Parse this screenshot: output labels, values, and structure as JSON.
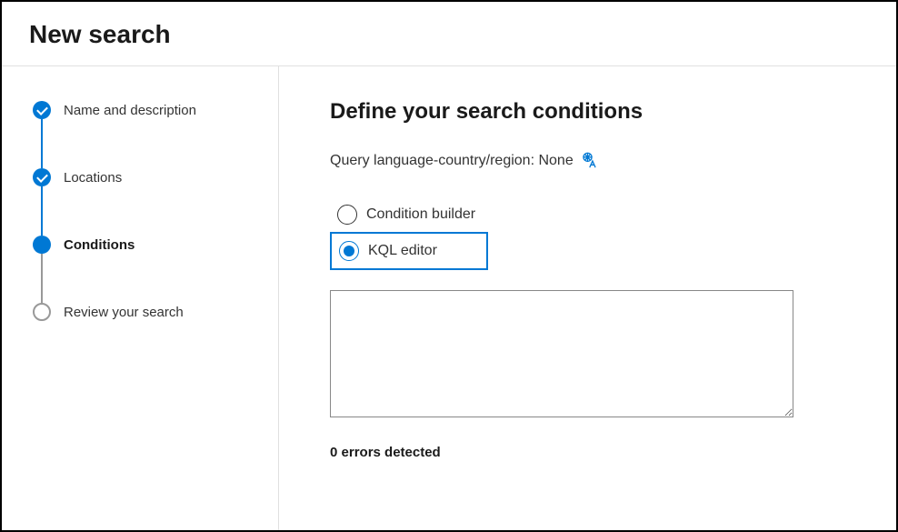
{
  "header": {
    "title": "New search"
  },
  "sidebar": {
    "steps": [
      {
        "label": "Name and description",
        "state": "completed"
      },
      {
        "label": "Locations",
        "state": "completed"
      },
      {
        "label": "Conditions",
        "state": "current"
      },
      {
        "label": "Review your search",
        "state": "pending"
      }
    ]
  },
  "main": {
    "heading": "Define your search conditions",
    "query_lang_label": "Query language-country/region: None",
    "radio_options": {
      "condition_builder": "Condition builder",
      "kql_editor": "KQL editor"
    },
    "kql_value": "",
    "kql_placeholder": "",
    "errors_text": "0 errors detected"
  },
  "colors": {
    "accent": "#0078d4"
  }
}
